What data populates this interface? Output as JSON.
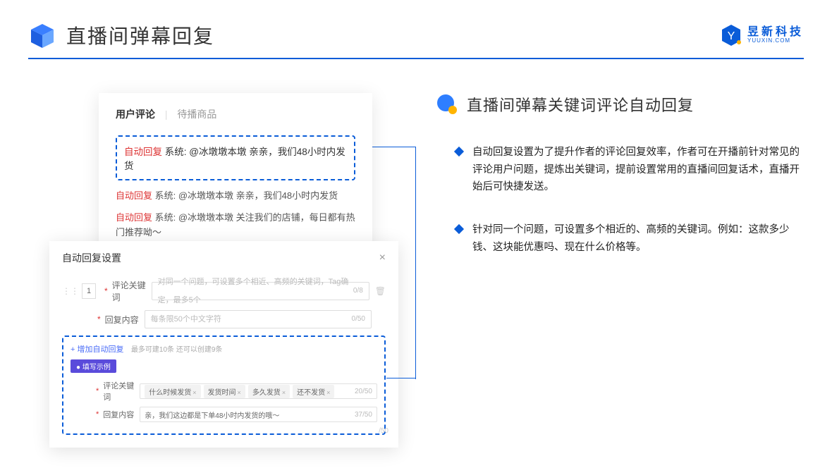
{
  "header": {
    "title": "直播间弹幕回复",
    "brand_name": "昱新科技",
    "brand_sub": "YUUXIN.COM"
  },
  "right": {
    "section_title": "直播间弹幕关键词评论自动回复",
    "bullet1": "自动回复设置为了提升作者的评论回复效率，作者可在开播前针对常见的评论用户问题，提炼出关键词，提前设置常用的直播间回复话术，直播开始后可快捷发送。",
    "bullet2": "针对同一个问题，可设置多个相近的、高频的关键词。例如：这款多少钱、这块能优惠吗、现在什么价格等。"
  },
  "card_top": {
    "tab1": "用户评论",
    "tab2": "待播商品",
    "line1_auto": "自动回复",
    "line1_sys": "系统: @冰墩墩本墩 亲亲，我们48小时内发货",
    "line2_auto": "自动回复",
    "line2_sys": "系统: @冰墩墩本墩 亲亲，我们48小时内发货",
    "line3_auto": "自动回复",
    "line3_sys": "系统: @冰墩墩本墩 关注我们的店铺，每日都有热门推荐呦～"
  },
  "card_bottom": {
    "modal_title": "自动回复设置",
    "idx": "1",
    "label_keyword": "评论关键词",
    "ph_keyword": "对同一个问题，可设置多个相近、高频的关键词，Tag确定，最多5个",
    "counter_keyword": "0/8",
    "label_content": "回复内容",
    "ph_content": "每条限50个中文字符",
    "counter_content": "0/50",
    "add_link": "+ 增加自动回复",
    "add_hint": "最多可建10条 还可以创建9条",
    "example_badge": "● 填写示例",
    "sub_label_kw": "评论关键词",
    "tags": [
      "什么时候发货",
      "发货时间",
      "多久发货",
      "还不发货"
    ],
    "sub_counter_kw": "20/50",
    "sub_label_ct": "回复内容",
    "sub_content": "亲，我们这边都是下单48小时内发货的哦～",
    "sub_counter_ct": "37/50",
    "outside_counter": "/50"
  }
}
